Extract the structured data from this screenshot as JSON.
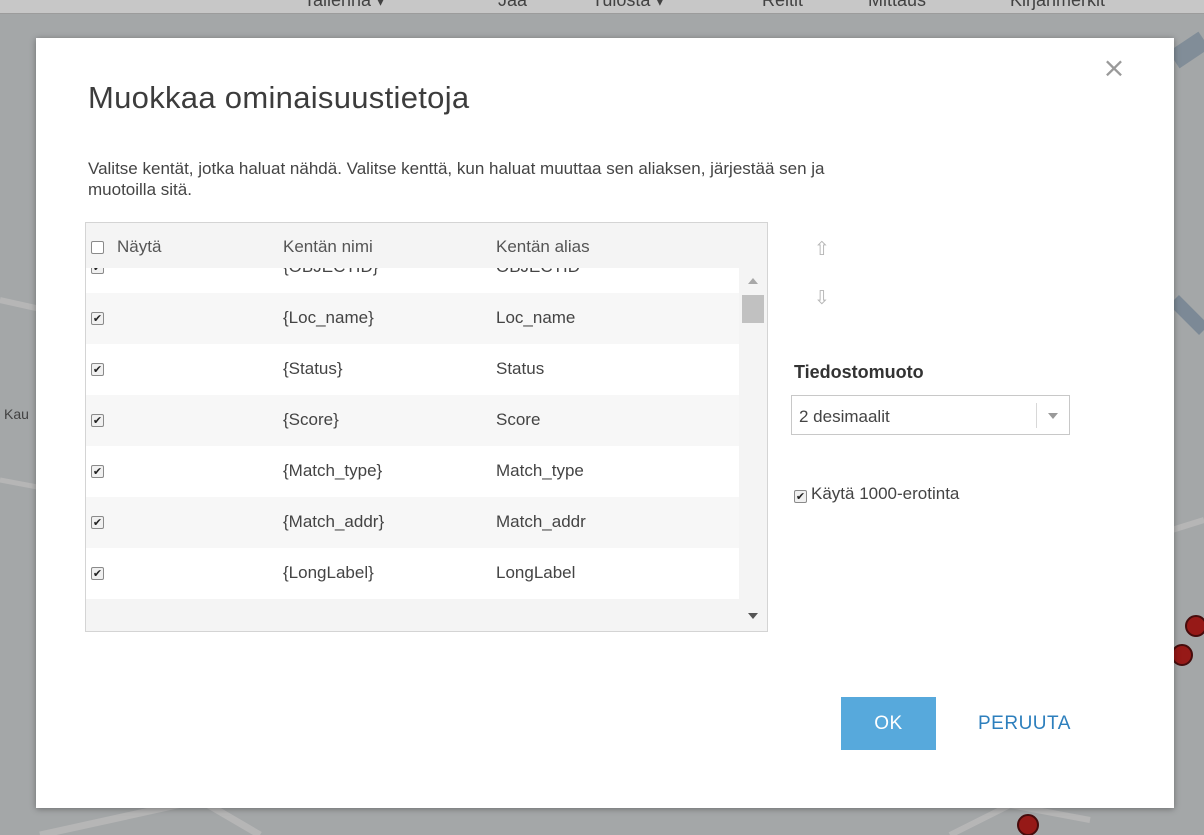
{
  "background_map": {
    "toolbar": {
      "items": [
        "Tallenna ▾",
        "Jaa",
        "Tulosta ▾",
        "Reitit",
        "Mittaus",
        "Kirjanmerkit"
      ]
    },
    "labels": [
      "Kau"
    ]
  },
  "dialog": {
    "title": "Muokkaa ominaisuustietoja",
    "close_symbol": "×",
    "description": "Valitse kentät, jotka haluat nähdä. Valitse kenttä, kun haluat muuttaa sen aliaksen, järjestää sen ja muotoilla sitä.",
    "table": {
      "headers": {
        "show": "Näytä",
        "field_name": "Kentän nimi",
        "field_alias": "Kentän alias"
      },
      "select_all_checked": false,
      "rows": [
        {
          "checked": true,
          "name": "{OBJECTID}",
          "alias": "OBJECTID"
        },
        {
          "checked": true,
          "name": "{Loc_name}",
          "alias": "Loc_name"
        },
        {
          "checked": true,
          "name": "{Status}",
          "alias": "Status"
        },
        {
          "checked": true,
          "name": "{Score}",
          "alias": "Score"
        },
        {
          "checked": true,
          "name": "{Match_type}",
          "alias": "Match_type"
        },
        {
          "checked": true,
          "name": "{Match_addr}",
          "alias": "Match_addr"
        },
        {
          "checked": true,
          "name": "{LongLabel}",
          "alias": "LongLabel"
        }
      ]
    },
    "move_up_icon": "arrow-up-icon",
    "move_down_icon": "arrow-down-icon",
    "format": {
      "label": "Tiedostomuoto",
      "selected": "2 desimaalit"
    },
    "thousands_separator": {
      "label": "Käytä 1000-erotinta",
      "checked": true
    },
    "buttons": {
      "ok": "OK",
      "cancel": "PERUUTA"
    }
  },
  "colors": {
    "ok_button": "#57a9dc",
    "cancel_text": "#2d7fbd",
    "map_marker": "#c0201e"
  }
}
